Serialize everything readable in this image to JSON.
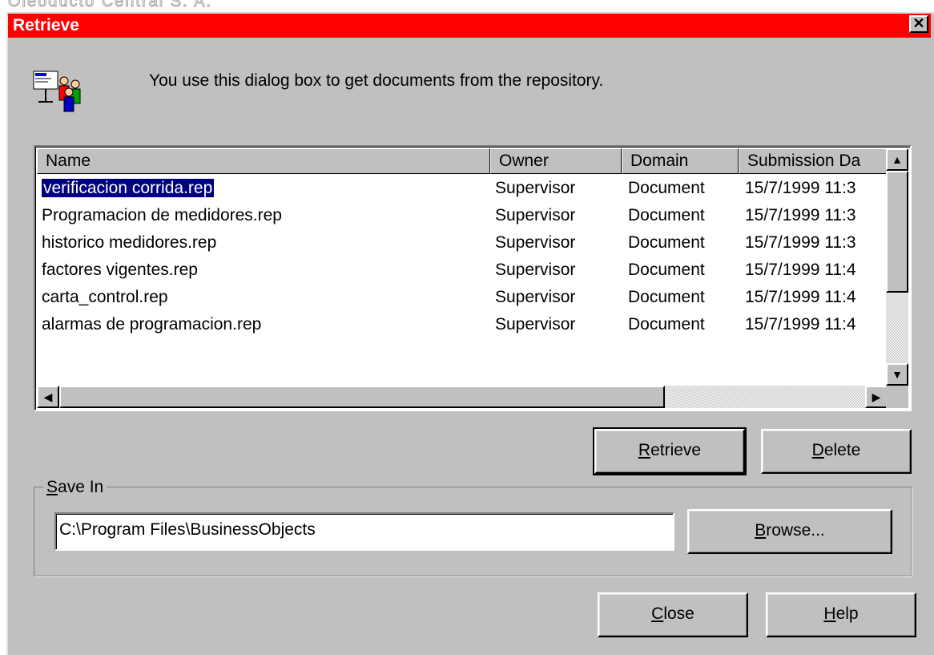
{
  "background_title": "Oleoducto Central S. A.",
  "window": {
    "title": "Retrieve",
    "close_glyph": "✕"
  },
  "description": "You use this dialog box to get documents from the repository.",
  "app_icon": "repository-users-icon",
  "list": {
    "columns": {
      "name": "Name",
      "owner": "Owner",
      "domain": "Domain",
      "submission_date": "Submission Da"
    },
    "rows": [
      {
        "name": "verificacion corrida.rep",
        "owner": "Supervisor",
        "domain": "Document",
        "date": "15/7/1999 11:3",
        "selected": true
      },
      {
        "name": "Programacion de medidores.rep",
        "owner": "Supervisor",
        "domain": "Document",
        "date": "15/7/1999 11:3"
      },
      {
        "name": "historico medidores.rep",
        "owner": "Supervisor",
        "domain": "Document",
        "date": "15/7/1999 11:3"
      },
      {
        "name": "factores vigentes.rep",
        "owner": "Supervisor",
        "domain": "Document",
        "date": "15/7/1999 11:4"
      },
      {
        "name": "carta_control.rep",
        "owner": "Supervisor",
        "domain": "Document",
        "date": "15/7/1999 11:4"
      },
      {
        "name": "alarmas de programacion.rep",
        "owner": "Supervisor",
        "domain": "Document",
        "date": "15/7/1999 11:4"
      }
    ]
  },
  "buttons": {
    "retrieve": {
      "accel": "R",
      "rest": "etrieve"
    },
    "delete": {
      "accel": "D",
      "rest": "elete"
    },
    "browse": {
      "accel": "B",
      "rest": "rowse..."
    },
    "close": {
      "accel": "C",
      "rest": "lose"
    },
    "help": {
      "accel": "H",
      "rest": "elp"
    }
  },
  "save_in": {
    "label_accel": "S",
    "label_rest": "ave In",
    "path": "C:\\Program Files\\BusinessObjects"
  },
  "colors": {
    "titlebar": "#ff0000",
    "face": "#c0c0c0",
    "selection": "#000080"
  }
}
